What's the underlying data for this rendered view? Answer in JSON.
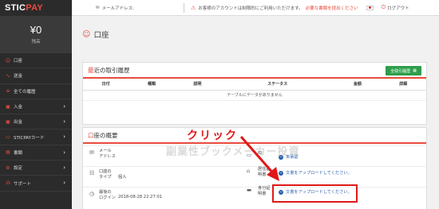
{
  "brand": {
    "logo_prefix": "STIC",
    "logo_suffix": "PAY"
  },
  "sidebar": {
    "balance": "¥0",
    "balance_label": "残高",
    "items": [
      {
        "label": "口座",
        "icon": "person-icon",
        "chevron": false
      },
      {
        "label": "送金",
        "icon": "chart-icon",
        "chevron": false
      },
      {
        "label": "全ての履歴",
        "icon": "list-icon",
        "chevron": false
      },
      {
        "label": "入金",
        "icon": "wallet-icon",
        "chevron": true
      },
      {
        "label": "出金",
        "icon": "wallet-icon",
        "chevron": true
      },
      {
        "label": "STICPAYカード",
        "icon": "card-icon",
        "chevron": true
      },
      {
        "label": "書類",
        "icon": "doc-icon",
        "chevron": true
      },
      {
        "label": "設定",
        "icon": "gear-icon",
        "chevron": true
      },
      {
        "label": "サポート",
        "icon": "headset-icon",
        "chevron": true
      }
    ]
  },
  "topbar": {
    "email_label": "メールアドレス:",
    "warning_text": "お客様のアカウントは制限的にご利用いただけます。",
    "warning_link": "必要な書類を提出ください",
    "logout": "ログアウト"
  },
  "page": {
    "title": "口座"
  },
  "history": {
    "title_first": "最",
    "title_rest": "近の取引履歴",
    "all_button": "全取引履歴",
    "columns": [
      "日付",
      "種類",
      "説明",
      "ステータス",
      "金額",
      "詳細"
    ],
    "empty": "テーブルにデータがありません"
  },
  "overview": {
    "title_first": "口",
    "title_rest": "座の概要",
    "rows": [
      {
        "key": "メール\nアドレス",
        "value": ""
      },
      {
        "key": "口座の\nタイプ",
        "value": "個人"
      },
      {
        "key": "最後の\nログイン",
        "value": "2018-08-28 22:27:01"
      }
    ],
    "docs": [
      {
        "key": "ID",
        "status": "未承認"
      },
      {
        "key": "居住証\n明書",
        "status": "文書をアップロードしてください。"
      },
      {
        "key": "身分証\n明書",
        "status": "文書をアップロードしてください。"
      }
    ]
  },
  "annotation": {
    "click": "クリック",
    "watermark": "副業性ブックメーカー投資"
  },
  "colors": {
    "accent": "#e84c3d",
    "green": "#2e9e4b",
    "link": "#2a5fab",
    "highlight": "#e01818"
  }
}
